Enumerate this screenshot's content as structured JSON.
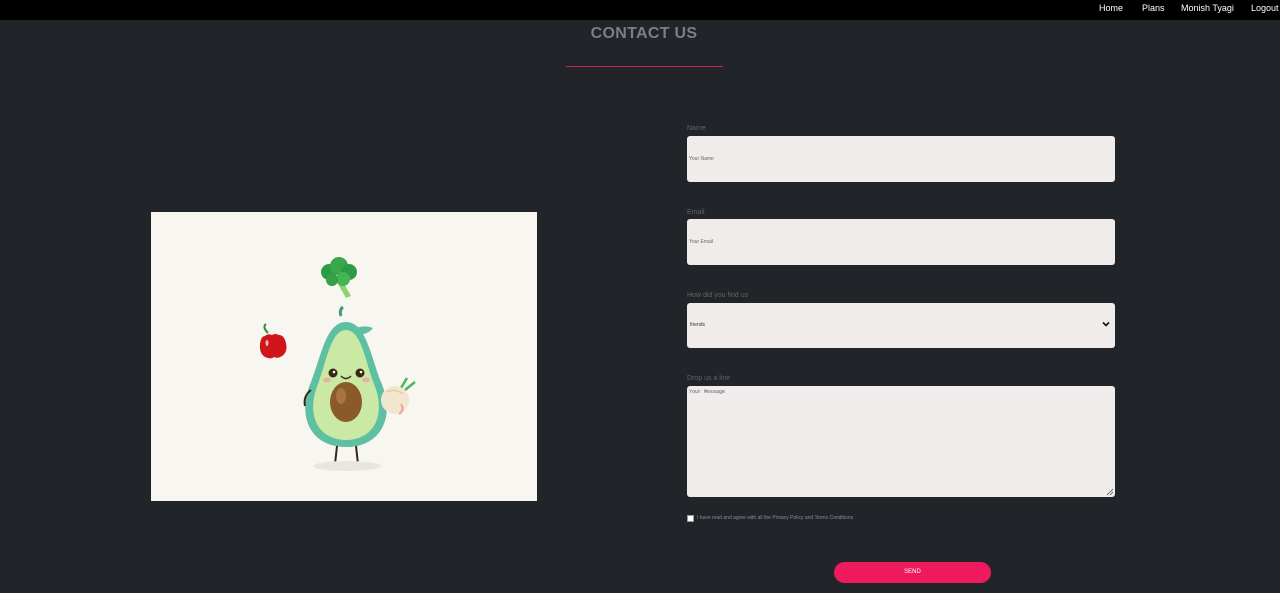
{
  "nav": {
    "items": [
      {
        "label": "Home"
      },
      {
        "label": "Plans"
      },
      {
        "label": "Monish Tyagi"
      },
      {
        "label": "Logout"
      }
    ]
  },
  "page": {
    "title": "CONTACT US"
  },
  "illustration": {
    "icon": "avocado-illustration",
    "colors": {
      "panel_bg": "#f8f6f1",
      "avocado_skin": "#5fbfa3",
      "avocado_flesh": "#c9e9a4",
      "pit": "#8b5a2b",
      "pepper": "#d0161c",
      "broccoli": "#3aa84a"
    }
  },
  "form": {
    "name": {
      "label": "Name",
      "placeholder": "Your Name",
      "value": ""
    },
    "email": {
      "label": "Email",
      "placeholder": "Your Email",
      "value": ""
    },
    "source": {
      "label": "How did you find us",
      "selected": "friends"
    },
    "message": {
      "label": "Drop us a line",
      "placeholder": "Your Message",
      "value": ""
    },
    "agree": {
      "label": "I have read and agree with all the Privacy Policy and Terms Conditions",
      "checked": false
    },
    "submit_label": "SEND"
  },
  "theme": {
    "background": "#212529",
    "topbar": "#000000",
    "accent": "#ef1a5d",
    "rule": "#c8274f",
    "field_bg": "#f1ecec"
  }
}
